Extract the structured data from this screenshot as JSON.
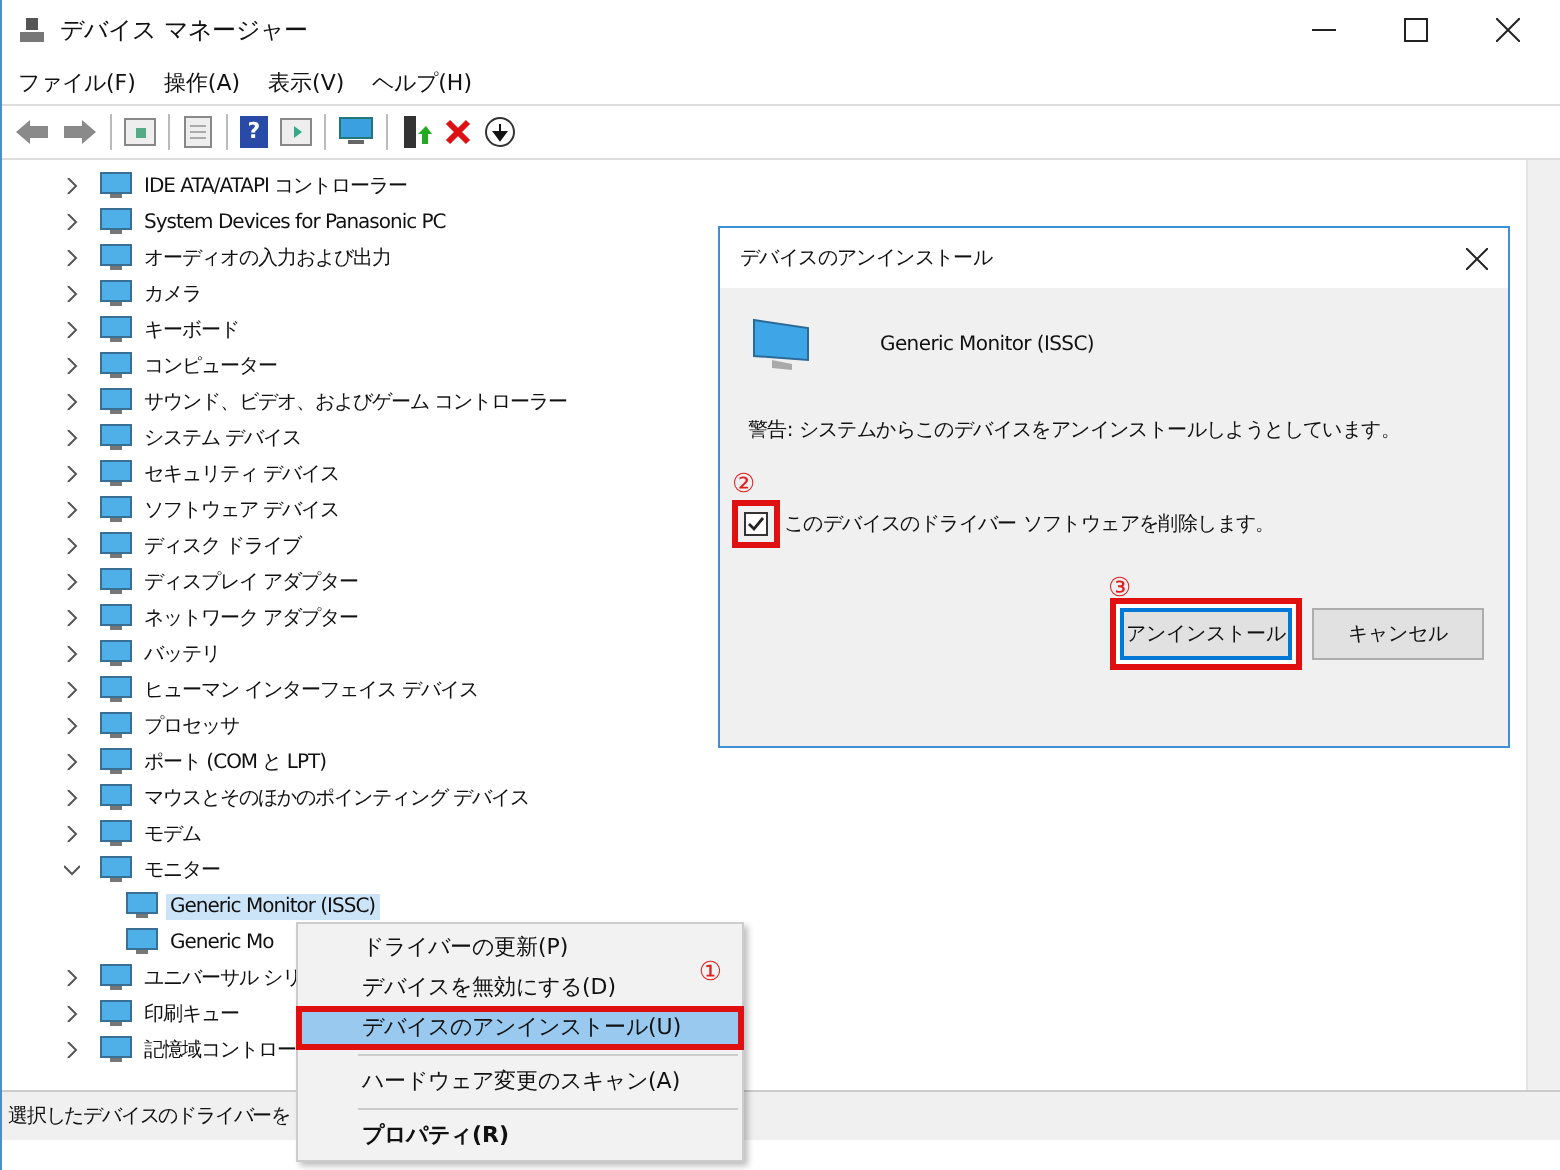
{
  "window": {
    "title": "デバイス マネージャー"
  },
  "menu": [
    "ファイル(F)",
    "操作(A)",
    "表示(V)",
    "ヘルプ(H)"
  ],
  "toolbar": {
    "help_label": "?"
  },
  "tree": [
    {
      "label": "IDE ATA/ATAPI コントローラー",
      "expanded": false,
      "selected": false
    },
    {
      "label": "System Devices for Panasonic PC",
      "expanded": false,
      "selected": false
    },
    {
      "label": "オーディオの入力および出力",
      "expanded": false,
      "selected": false
    },
    {
      "label": "カメラ",
      "expanded": false,
      "selected": false
    },
    {
      "label": "キーボード",
      "expanded": false,
      "selected": false
    },
    {
      "label": "コンピューター",
      "expanded": false,
      "selected": false
    },
    {
      "label": "サウンド、ビデオ、およびゲーム コントローラー",
      "expanded": false,
      "selected": false
    },
    {
      "label": "システム デバイス",
      "expanded": false,
      "selected": false
    },
    {
      "label": "セキュリティ デバイス",
      "expanded": false,
      "selected": false
    },
    {
      "label": "ソフトウェア デバイス",
      "expanded": false,
      "selected": false
    },
    {
      "label": "ディスク ドライブ",
      "expanded": false,
      "selected": false
    },
    {
      "label": "ディスプレイ アダプター",
      "expanded": false,
      "selected": false
    },
    {
      "label": "ネットワーク アダプター",
      "expanded": false,
      "selected": false
    },
    {
      "label": "バッテリ",
      "expanded": false,
      "selected": false
    },
    {
      "label": "ヒューマン インターフェイス デバイス",
      "expanded": false,
      "selected": false
    },
    {
      "label": "プロセッサ",
      "expanded": false,
      "selected": false
    },
    {
      "label": "ポート (COM と LPT)",
      "expanded": false,
      "selected": false
    },
    {
      "label": "マウスとそのほかのポインティング デバイス",
      "expanded": false,
      "selected": false
    },
    {
      "label": "モデム",
      "expanded": false,
      "selected": false
    },
    {
      "label": "モニター",
      "expanded": true,
      "selected": false,
      "children": [
        {
          "label": "Generic Monitor (ISSC)",
          "selected": true
        },
        {
          "label": "Generic Mo",
          "selected": false
        }
      ]
    },
    {
      "label": "ユニバーサル シリ",
      "expanded": false,
      "selected": false
    },
    {
      "label": "印刷キュー",
      "expanded": false,
      "selected": false
    },
    {
      "label": "記憶域コントロー",
      "expanded": false,
      "selected": false
    }
  ],
  "status_bar": "選択したデバイスのドライバーを",
  "context_menu": {
    "annotation": "①",
    "items": [
      {
        "kind": "item",
        "label": "ドライバーの更新(P)",
        "selected": false,
        "annotated": false
      },
      {
        "kind": "item",
        "label": "デバイスを無効にする(D)",
        "selected": false,
        "annotated": false
      },
      {
        "kind": "item",
        "label": "デバイスのアンインストール(U)",
        "selected": true,
        "annotated": true
      },
      {
        "kind": "separator"
      },
      {
        "kind": "item",
        "label": "ハードウェア変更のスキャン(A)",
        "selected": false,
        "annotated": false
      },
      {
        "kind": "separator"
      },
      {
        "kind": "default",
        "label": "プロパティ(R)",
        "selected": false,
        "annotated": false
      }
    ]
  },
  "dialog": {
    "title": "デバイスのアンインストール",
    "device": "Generic Monitor (ISSC)",
    "warning": "警告: システムからこのデバイスをアンインストールしようとしています。",
    "checkbox": {
      "annotation": "②",
      "label": "このデバイスのドライバー ソフトウェアを削除します。",
      "checked": true
    },
    "buttons_annotation": "③",
    "buttons": [
      {
        "label": "アンインストール",
        "annotated": true,
        "default": true
      },
      {
        "label": "キャンセル",
        "annotated": false,
        "default": false
      }
    ]
  }
}
